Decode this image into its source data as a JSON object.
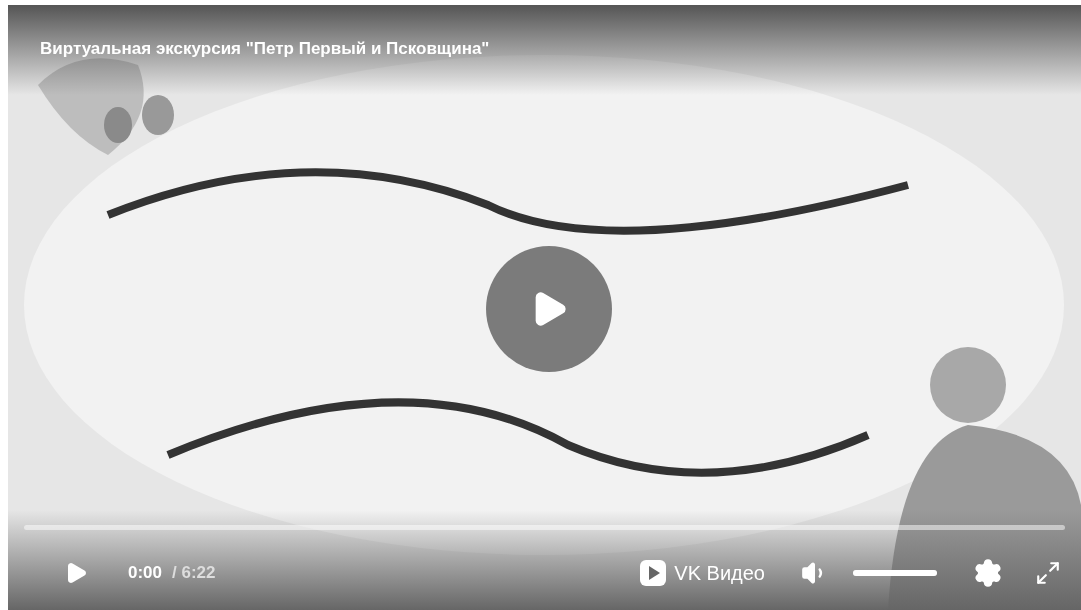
{
  "video": {
    "kind": "picture",
    "title": "Виртуальная экскурсия \"Петр Первый и Псковщина\""
  },
  "progress": {
    "level": 0
  },
  "controls": {
    "current_time": "0:00",
    "duration": "/ 6:22",
    "brand": "VK Видео",
    "volume": {
      "level": 1,
      "muted": false
    }
  }
}
